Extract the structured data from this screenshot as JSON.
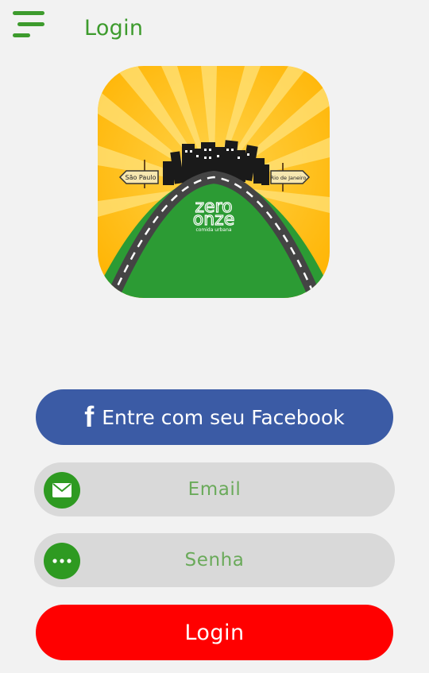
{
  "header": {
    "title": "Login",
    "menu_icon": "hamburger-menu-icon"
  },
  "logo": {
    "brand_line1": "zero",
    "brand_line2": "onze",
    "tagline": "comida urbana",
    "sign_left": "São Paulo",
    "sign_right": "Rio de Janeiro"
  },
  "facebook_button": {
    "icon": "f",
    "label": "Entre com seu Facebook"
  },
  "email_field": {
    "placeholder": "Email",
    "icon": "envelope-icon"
  },
  "password_field": {
    "placeholder": "Senha",
    "icon": "dots-icon"
  },
  "login_button": {
    "label": "Login"
  },
  "colors": {
    "accent_green": "#3d9b2d",
    "facebook_blue": "#3b5ba5",
    "login_red": "#ff0000",
    "field_bg": "#d9d9d9"
  }
}
